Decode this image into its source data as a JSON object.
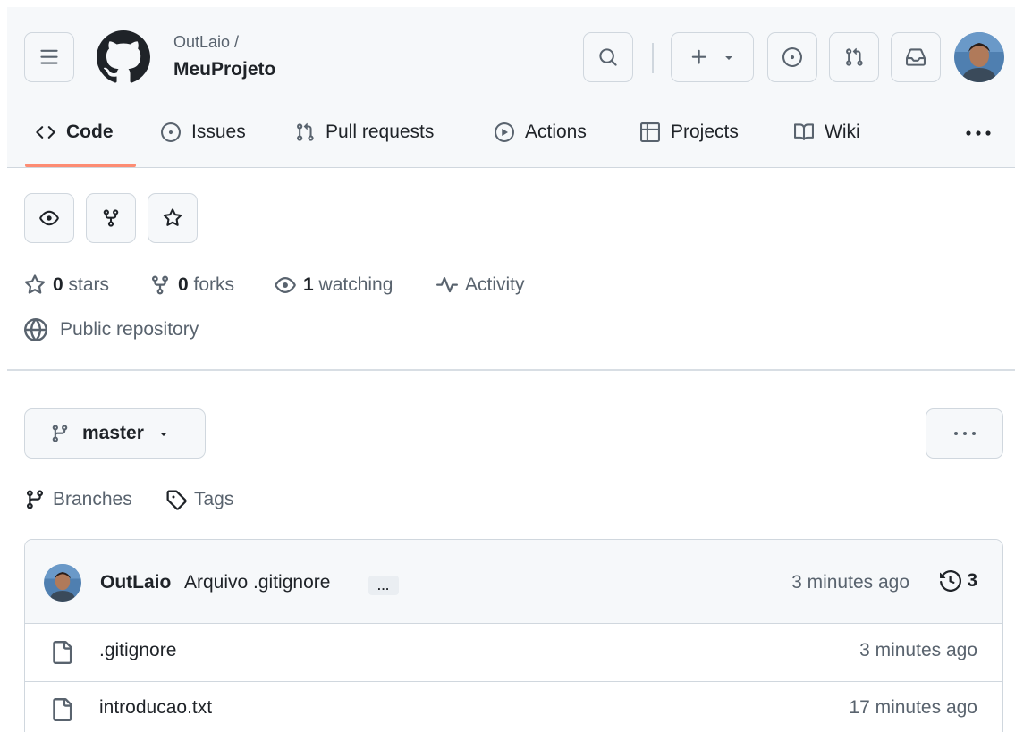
{
  "header": {
    "owner": "OutLaio /",
    "repo": "MeuProjeto"
  },
  "tabs": [
    {
      "label": "Code",
      "icon": "code-icon",
      "selected": true
    },
    {
      "label": "Issues",
      "icon": "issue-opened-icon"
    },
    {
      "label": "Pull requests",
      "icon": "git-pull-request-icon"
    },
    {
      "label": "Actions",
      "icon": "play-icon"
    },
    {
      "label": "Projects",
      "icon": "table-icon"
    },
    {
      "label": "Wiki",
      "icon": "book-icon"
    }
  ],
  "stats": {
    "stars_count": "0",
    "stars_label": "stars",
    "forks_count": "0",
    "forks_label": "forks",
    "watching_count": "1",
    "watching_label": "watching",
    "activity_label": "Activity",
    "visibility": "Public repository"
  },
  "branch": {
    "current": "master",
    "branches_label": "Branches",
    "tags_label": "Tags"
  },
  "latest_commit": {
    "author": "OutLaio",
    "message": "Arquivo .gitignore",
    "ellipsis": "...",
    "time": "3 minutes ago",
    "commit_count": "3"
  },
  "files": [
    {
      "name": ".gitignore",
      "time": "3 minutes ago"
    },
    {
      "name": "introducao.txt",
      "time": "17 minutes ago"
    }
  ],
  "colors": {
    "accent_underline": "#fd8c73",
    "text_primary": "#1f2328",
    "text_muted": "#59636e",
    "border": "#d0d7de",
    "subtle_bg": "#f6f8fa"
  }
}
